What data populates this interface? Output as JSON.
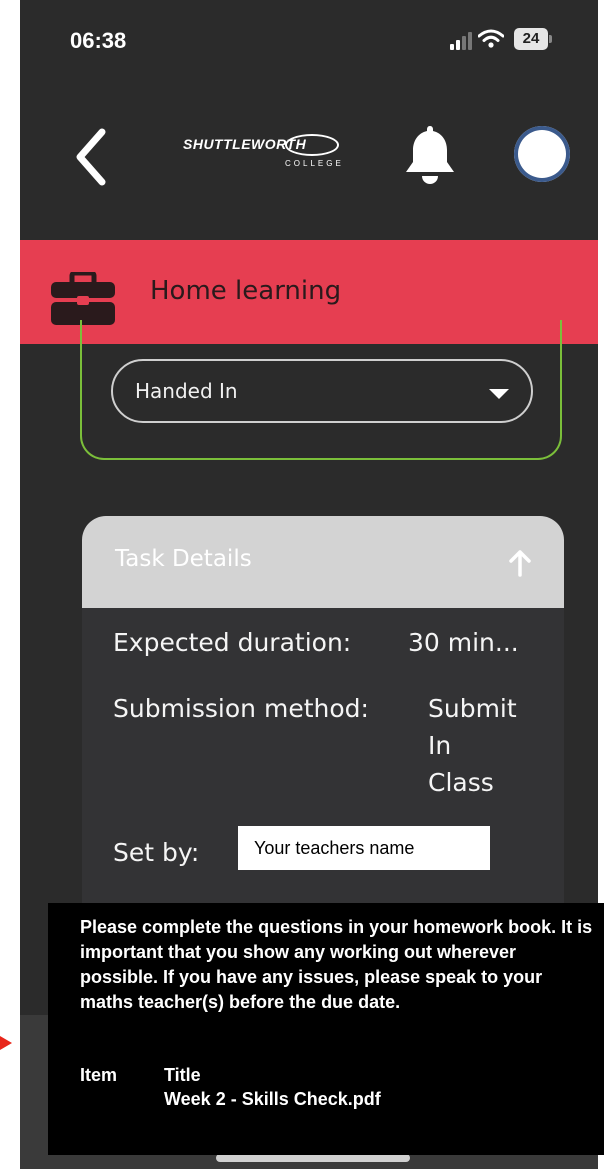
{
  "status_bar": {
    "time": "06:38",
    "battery": "24"
  },
  "header": {
    "logo_main": "SHUTTLEWORTH",
    "logo_sub": "COLLEGE"
  },
  "banner": {
    "title": "Home learning"
  },
  "filter": {
    "status_value": "Handed In"
  },
  "task_details": {
    "title": "Task Details",
    "duration_label": "Expected duration:",
    "duration_value": "30 min...",
    "method_label": "Submission method:",
    "method_value_1": "Submit",
    "method_value_2": "In",
    "method_value_3": "Class",
    "set_by_label": "Set by:",
    "set_by_value": "Your teachers name"
  },
  "overlay": {
    "description": "Please complete the questions in your homework book. It is important that you show any working out wherever possible. If you have any issues, please speak to your maths teacher(s) before the due date.",
    "item_header": "Item",
    "title_header": "Title",
    "file_name": "Week 2 - Skills Check.pdf"
  },
  "colors": {
    "banner": "#e63e51",
    "filter_border": "#7bbf3a",
    "background": "#2b2b2b",
    "annotation_arrow": "#e8261a"
  },
  "icons": [
    "back-chevron-icon",
    "bell-icon",
    "briefcase-icon",
    "dropdown-caret-icon",
    "arrow-up-icon",
    "signal-icon",
    "wifi-icon",
    "battery-icon"
  ]
}
